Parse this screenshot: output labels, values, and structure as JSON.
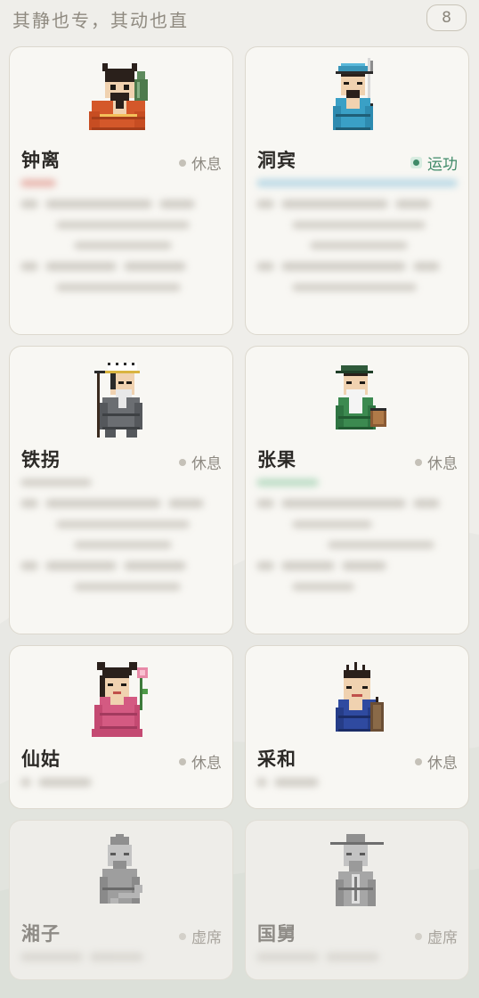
{
  "header": {
    "title": "其静也专，其动也直",
    "count": "8"
  },
  "cards": [
    {
      "name": "钟离",
      "status": "休息",
      "state": "idle",
      "figure": "zhongli-figure"
    },
    {
      "name": "洞宾",
      "status": "运功",
      "state": "active",
      "figure": "dongbin-figure"
    },
    {
      "name": "铁拐",
      "status": "休息",
      "state": "idle",
      "figure": "tieguai-figure"
    },
    {
      "name": "张果",
      "status": "休息",
      "state": "idle",
      "figure": "zhangguo-figure"
    },
    {
      "name": "仙姑",
      "status": "休息",
      "state": "idle",
      "figure": "xiangu-figure"
    },
    {
      "name": "采和",
      "status": "休息",
      "state": "idle",
      "figure": "caihe-figure"
    },
    {
      "name": "湘子",
      "status": "虚席",
      "state": "vacant",
      "figure": "xiangzi-figure"
    },
    {
      "name": "国舅",
      "status": "虚席",
      "state": "vacant",
      "figure": "guojiu-figure"
    }
  ],
  "colors": {
    "background": "#efeeea",
    "card": "#f8f7f3",
    "active_status": "#3f8a68",
    "idle_status": "#8e8a82"
  }
}
